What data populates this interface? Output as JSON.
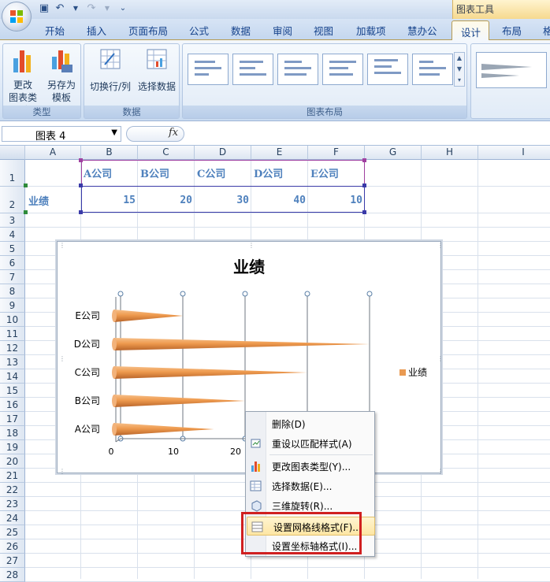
{
  "context_tab_group": "图表工具",
  "tabs": [
    "开始",
    "插入",
    "页面布局",
    "公式",
    "数据",
    "审阅",
    "视图",
    "加载项",
    "慧办公",
    "设计",
    "布局",
    "格"
  ],
  "active_tab": "设计",
  "ribbon": {
    "groups": {
      "type": {
        "label": "类型",
        "change_type": "更改\n图表类型",
        "save_template": "另存为\n模板"
      },
      "data": {
        "label": "数据",
        "switch": "切换行/列",
        "select": "选择数据"
      },
      "layout": {
        "label": "图表布局"
      }
    }
  },
  "formula_bar": {
    "name_box": "图表 4",
    "fx": "fx"
  },
  "columns": [
    "A",
    "B",
    "C",
    "D",
    "E",
    "F",
    "G",
    "H",
    "I"
  ],
  "rows": [
    "1",
    "2",
    "3",
    "4",
    "5",
    "6",
    "7",
    "8",
    "9",
    "10",
    "11",
    "12",
    "13",
    "14",
    "15",
    "16",
    "17",
    "18",
    "19",
    "20",
    "21",
    "22",
    "23",
    "24",
    "25",
    "26",
    "27",
    "28"
  ],
  "sheet": {
    "headers": [
      "A公司",
      "B公司",
      "C公司",
      "D公司",
      "E公司"
    ],
    "row_label": "业绩",
    "values": [
      "15",
      "20",
      "30",
      "40",
      "10"
    ]
  },
  "chart_data": {
    "type": "bar",
    "title": "业绩",
    "categories": [
      "A公司",
      "B公司",
      "C公司",
      "D公司",
      "E公司"
    ],
    "series": [
      {
        "name": "业绩",
        "values": [
          15,
          20,
          30,
          40,
          10
        ]
      }
    ],
    "x_ticks": [
      "0",
      "10",
      "20"
    ],
    "xlim": [
      0,
      40
    ],
    "legend": "right",
    "bar_color": "#e99a52",
    "grid": true
  },
  "context_menu": {
    "items": [
      {
        "label": "删除(D)",
        "icon": ""
      },
      {
        "label": "重设以匹配样式(A)",
        "icon": "reset-style-icon"
      },
      {
        "label": "更改图表类型(Y)...",
        "icon": "chart-type-icon"
      },
      {
        "label": "选择数据(E)...",
        "icon": "select-data-icon"
      },
      {
        "label": "三维旋转(R)...",
        "icon": "rotate-3d-icon"
      },
      {
        "label": "设置网格线格式(F)...",
        "icon": "gridline-format-icon"
      },
      {
        "label": "设置坐标轴格式(I)...",
        "icon": ""
      }
    ],
    "highlighted_index": 5
  }
}
